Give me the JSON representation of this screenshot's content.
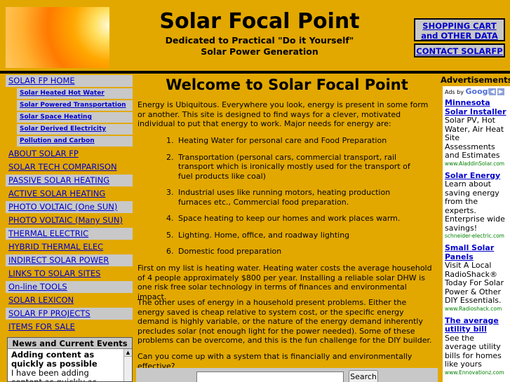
{
  "header": {
    "site_title": "Solar Focal Point",
    "tagline_line1": "Dedicated to Practical \"Do it Yourself\"",
    "tagline_line2": "Solar Power Generation",
    "cart_line1": "SHOPPING CART",
    "cart_line2": "and OTHER DATA",
    "contact": "CONTACT SOLARFP"
  },
  "nav": {
    "home": "SOLAR FP HOME",
    "sub": [
      "Solar Heated Hot Water",
      "Solar Powered Transportation",
      "Solar Space Heating",
      "Solar Derived Electricity",
      "Pollution and Carbon"
    ],
    "items": [
      "ABOUT SOLAR FP",
      "SOLAR TECH COMPARISON",
      "PASSIVE SOLAR HEATING",
      "ACTIVE SOLAR HEATING",
      "PHOTO VOLTAIC (One SUN)",
      "PHOTO VOLTAIC (Many SUN)",
      "THERMAL ELECTRIC",
      "HYBRID THERMAL ELEC",
      "INDIRECT SOLAR POWER",
      "LINKS TO SOLAR SITES",
      "On-line TOOLS",
      "SOLAR LEXICON",
      "SOLAR FP PROJECTS",
      "ITEMS FOR SALE"
    ]
  },
  "news": {
    "heading": "News and Current Events",
    "item_title": "Adding content as quickly as possible",
    "item_text": "I have been adding content as quickly as possible to fill"
  },
  "main": {
    "heading": "Welcome to Solar Focal Point",
    "intro": "Energy is Ubiquitous. Everywhere you look, energy is present in some form or another. This site is designed to find ways for a clever, motivated individual to put that energy to work. Major needs for energy are:",
    "needs": [
      "Heating Water for personal care and Food Preparation",
      "Transportation (personal cars, commercial transport, rail transport which is ironically mostly used for the transport of fuel products like coal)",
      "Industrial uses like running motors, heating production furnaces etc., Commercial food preparation.",
      "Space heating to keep our homes and work places warm.",
      "Lighting. Home, office, and roadway lighting",
      "Domestic food preparation"
    ],
    "para1": "First on my list is heating water. Heating water costs the average household of 4 people approximately $800 per year. Installing a reliable solar DHW is one risk free solar technology in terms of finances and environmental impact.",
    "para2": "The other uses of energy in a household present problems. Either the energy saved is cheap relative to system cost, or the specific energy demand is highly variable, or the nature of the energy demand inherently precludes solar (not enough light for the power needed). Some of these problems can be overcome, and this is the fun challenge for the DIY builder.",
    "para3": "Can you come up with a system that is financially and environmentally effective?",
    "search_button": "Search"
  },
  "ads": {
    "title": "Advertisements",
    "ads_by": "Ads by",
    "google": "Google",
    "items": [
      {
        "title": "Minnesota Solar Installer",
        "desc": "Solar PV, Hot Water, Air Heat Site Assessments and Estimates",
        "url": "www.AladdinSolar.com"
      },
      {
        "title": "Solar Energy",
        "desc": "Learn about saving energy from the experts. Enterprise wide savings!",
        "url": "schneider-electric.com"
      },
      {
        "title": "Small Solar Panels",
        "desc": "Visit A Local RadioShack® Today For Solar Power & Other DIY Essentials.",
        "url": "www.Radioshack.com"
      },
      {
        "title": "The average utility bill",
        "desc": "See the average utility bills for homes like yours",
        "url": "www.Ennovationz.com"
      }
    ]
  }
}
